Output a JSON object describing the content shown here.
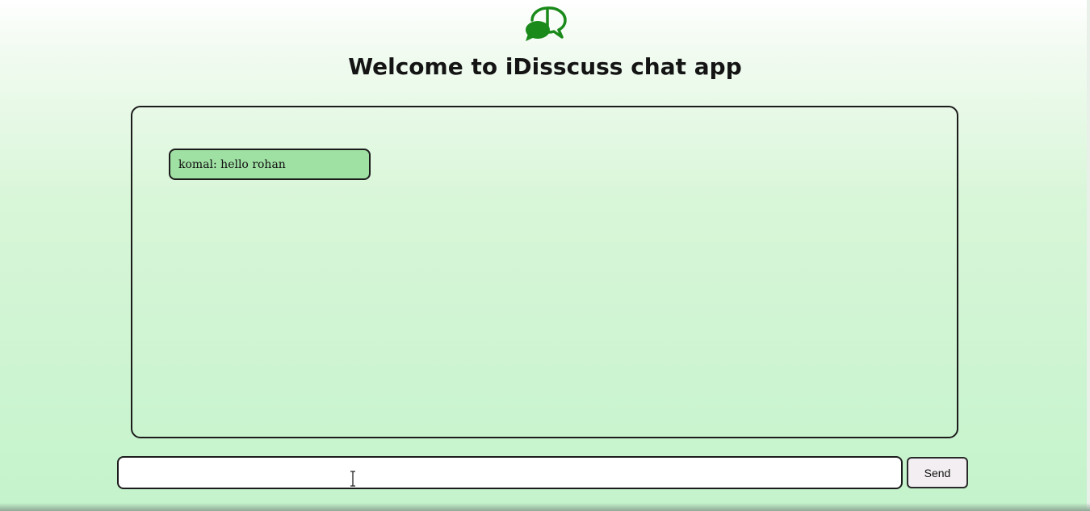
{
  "app": {
    "title": "Welcome to iDisscuss chat app",
    "logo_icon": "chat-bubbles-icon",
    "accent_color": "#1a8a1a"
  },
  "chat": {
    "messages": [
      {
        "text": "komal: hello rohan",
        "side": "left",
        "bubble_color": "#9fe0a3"
      }
    ]
  },
  "composer": {
    "input_value": "",
    "send_label": "Send"
  }
}
